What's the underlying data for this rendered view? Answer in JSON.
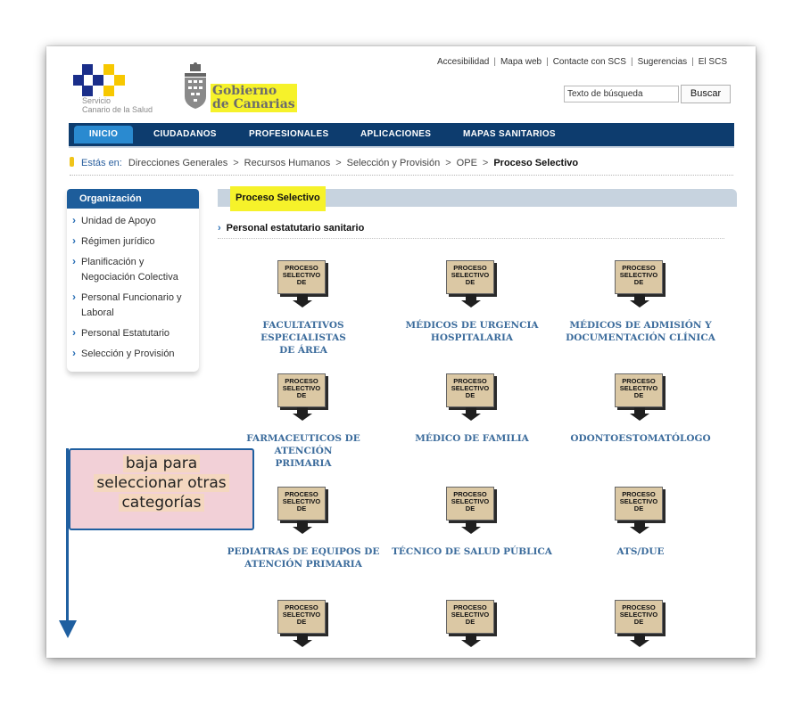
{
  "header": {
    "scs_logo_text": [
      "Servicio",
      "Canario de la Salud"
    ],
    "gobierno_logo_text": [
      "Gobierno",
      "de Canarias"
    ],
    "top_links": [
      "Accesibilidad",
      "Mapa web",
      "Contacte con SCS",
      "Sugerencias",
      "El SCS"
    ],
    "search_placeholder": "Texto de búsqueda",
    "search_button": "Buscar",
    "colors": {
      "scs_blue": "#1a2e8a",
      "scs_yellow": "#f7c800",
      "nav_bg": "#0d3c6e",
      "highlight": "#f6f22a"
    }
  },
  "nav": {
    "items": [
      "INICIO",
      "CIUDADANOS",
      "PROFESIONALES",
      "APLICACIONES",
      "MAPAS SANITARIOS"
    ],
    "active": "INICIO"
  },
  "breadcrumb": {
    "label": "Estás en:",
    "items": [
      "Direcciones Generales",
      "Recursos Humanos",
      "Selección y Provisión",
      "OPE"
    ],
    "current": "Proceso Selectivo"
  },
  "sidebar": {
    "title": "Organización",
    "items": [
      [
        "Unidad de Apoyo"
      ],
      [
        "Régimen jurídico"
      ],
      [
        "Planificación y",
        "Negociación Colectiva"
      ],
      [
        "Personal Funcionario y",
        "Laboral"
      ],
      [
        "Personal Estatutario"
      ],
      [
        "Selección y Provisión"
      ]
    ]
  },
  "main": {
    "title": "Proceso Selectivo",
    "section": "Personal estatutario sanitario",
    "icon_text": [
      "PROCESO",
      "SELECTIVO",
      "DE"
    ],
    "categories": [
      [
        "FACULTATIVOS ESPECIALISTAS",
        "DE ÁREA"
      ],
      [
        "MÉDICOS DE URGENCIA",
        "HOSPITALARIA"
      ],
      [
        "MÉDICOS DE ADMISIÓN Y",
        "DOCUMENTACIÓN CLÍNICA"
      ],
      [
        "FARMACEUTICOS DE ATENCIÓN",
        "PRIMARIA"
      ],
      [
        "MÉDICO DE FAMILIA"
      ],
      [
        "ODONTOESTOMATÓLOGO"
      ],
      [
        "PEDIATRAS DE EQUIPOS DE",
        "ATENCIÓN PRIMARIA"
      ],
      [
        "TÉCNICO DE SALUD PÚBLICA"
      ],
      [
        "ATS/DUE"
      ],
      [],
      [],
      []
    ]
  },
  "annotation": {
    "lines": [
      "baja para",
      "seleccionar otras",
      "categorías"
    ]
  }
}
